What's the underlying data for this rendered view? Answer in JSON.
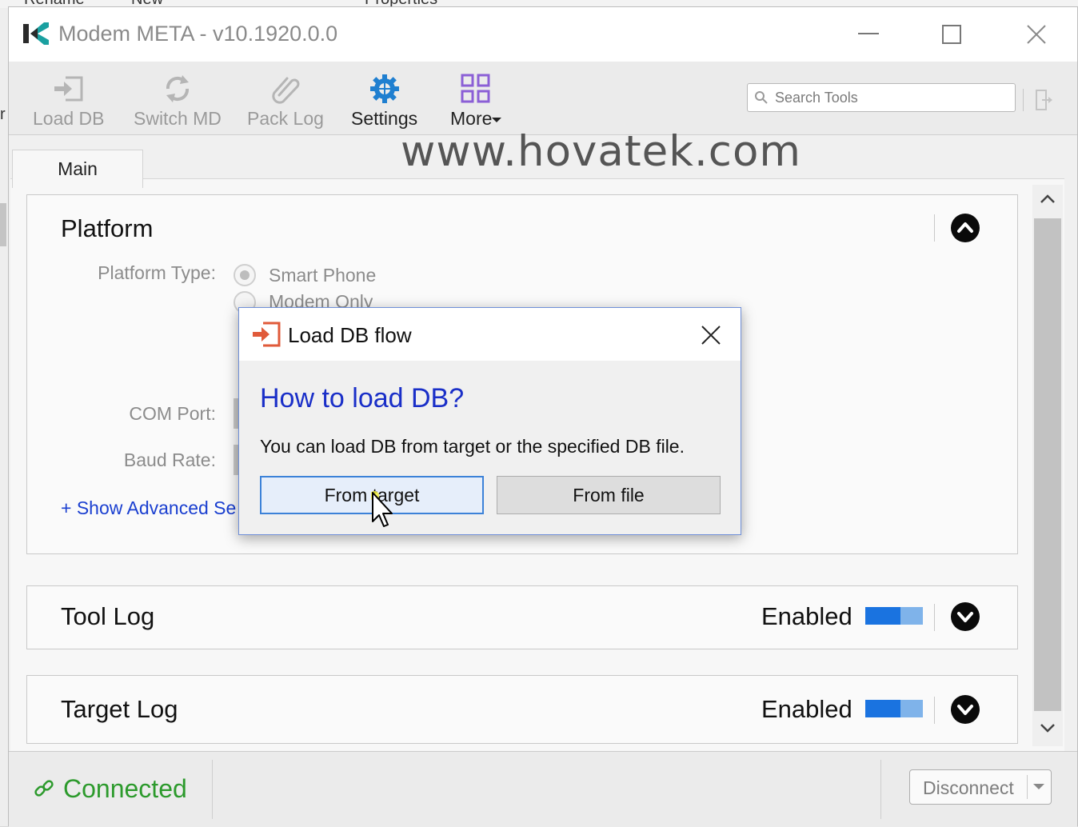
{
  "background": {
    "explorer_labels": [
      "Rename",
      "New",
      "Properties"
    ]
  },
  "window": {
    "title": "Modem META - v10.1920.0.0"
  },
  "toolbar": {
    "items": [
      {
        "label": "Load DB",
        "icon": "load-db-icon"
      },
      {
        "label": "Switch MD",
        "icon": "switch-md-icon"
      },
      {
        "label": "Pack Log",
        "icon": "paperclip-icon"
      },
      {
        "label": "Settings",
        "icon": "gear-icon"
      },
      {
        "label": "More",
        "icon": "grid-icon"
      }
    ],
    "search_placeholder": "Search Tools"
  },
  "watermark": "www.hovatek.com",
  "tabs": [
    {
      "label": "Main"
    }
  ],
  "platform": {
    "title": "Platform",
    "platform_type_label": "Platform Type:",
    "options": [
      "Smart Phone",
      "Modem Only"
    ],
    "com_port_label": "COM Port:",
    "baud_rate_label": "Baud Rate:",
    "advanced_link": "+ Show Advanced Se"
  },
  "tool_log": {
    "title": "Tool Log",
    "status": "Enabled"
  },
  "target_log": {
    "title": "Target Log",
    "status": "Enabled"
  },
  "status": {
    "text": "Connected",
    "disconnect_label": "Disconnect"
  },
  "dialog": {
    "title": "Load DB flow",
    "heading": "How to load DB?",
    "message": "You can load DB from target or the specified DB file.",
    "btn_target": "From target",
    "btn_file": "From file"
  },
  "colors": {
    "accent_blue": "#1a73e0",
    "status_green": "#2c9a2c",
    "link_blue": "#1a3fd0",
    "dialog_heading": "#1a2fc8"
  }
}
